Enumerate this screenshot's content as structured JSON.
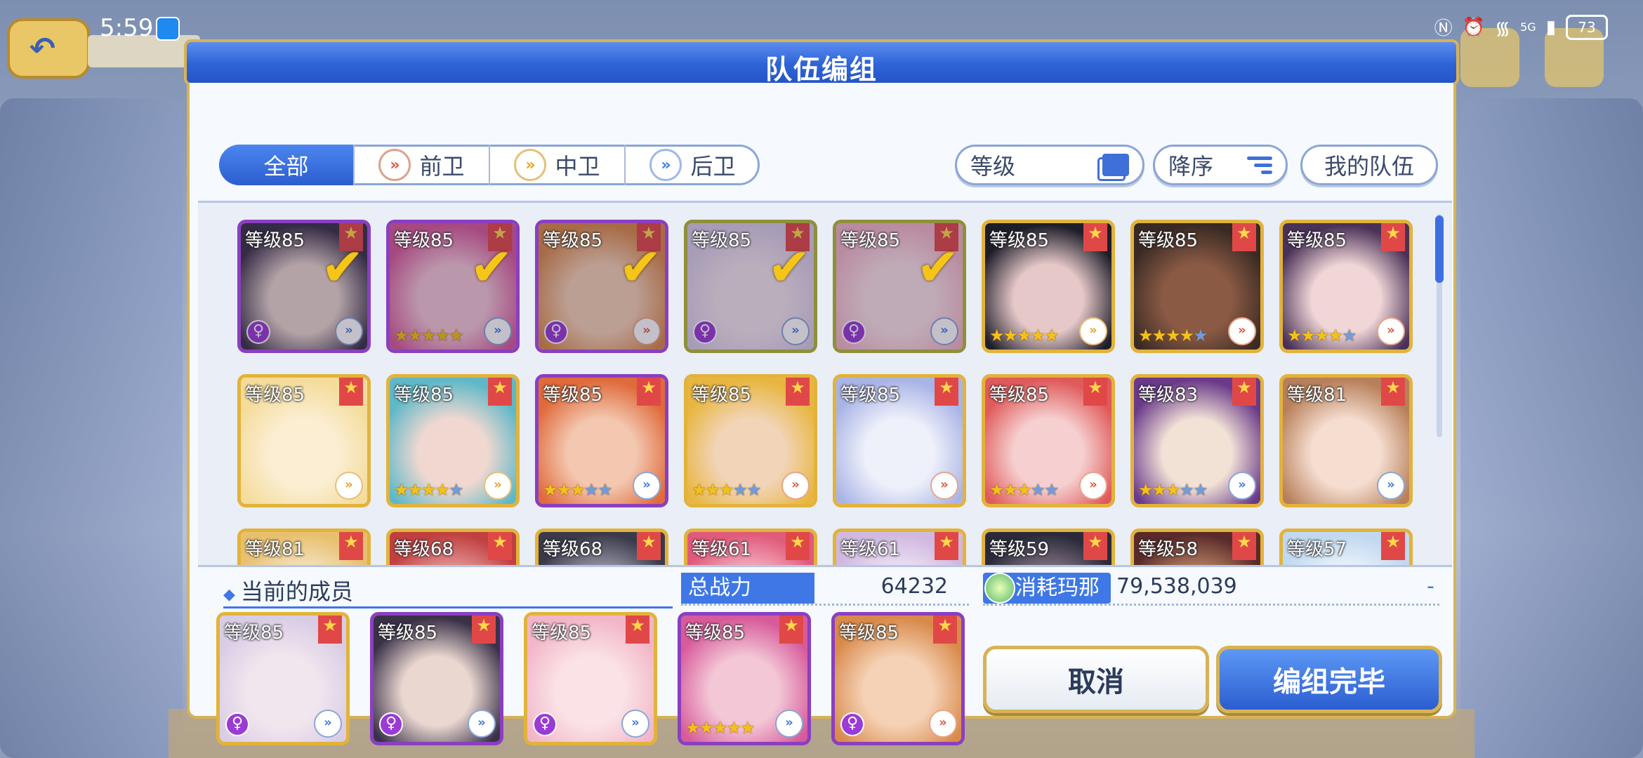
{
  "status_bar": {
    "time": "5:59",
    "battery": "73",
    "network": "5G"
  },
  "dialog": {
    "title": "队伍编组"
  },
  "filters": {
    "tabs": [
      {
        "label": "全部",
        "icon": "",
        "active": true
      },
      {
        "label": "前卫",
        "icon": "front-position-icon",
        "active": false
      },
      {
        "label": "中卫",
        "icon": "mid-position-icon",
        "active": false
      },
      {
        "label": "后卫",
        "icon": "back-position-icon",
        "active": false
      }
    ],
    "level_label": "等级",
    "order_label": "降序",
    "myteam_label": "我的队伍"
  },
  "roster": [
    {
      "level": "等级85",
      "stars": 0,
      "pos": "back",
      "selected": true,
      "badge": true,
      "frame": "purple",
      "art": [
        "#3a3148",
        "#e9d7d0"
      ]
    },
    {
      "level": "等级85",
      "stars": 5,
      "pos": "back",
      "selected": true,
      "badge": false,
      "frame": "purple",
      "art": [
        "#d75a9a",
        "#f3c7d6"
      ]
    },
    {
      "level": "等级85",
      "stars": 0,
      "pos": "front",
      "selected": true,
      "badge": true,
      "frame": "purple",
      "art": [
        "#d98a4a",
        "#f5d1b5"
      ]
    },
    {
      "level": "等级85",
      "stars": 0,
      "pos": "back",
      "selected": true,
      "badge": true,
      "frame": "green",
      "art": [
        "#d9cde6",
        "#f2e6ee"
      ]
    },
    {
      "level": "等级85",
      "stars": 0,
      "pos": "back",
      "selected": true,
      "badge": true,
      "frame": "green",
      "art": [
        "#f2b6c8",
        "#fae2e6"
      ]
    },
    {
      "level": "等级85",
      "stars": 5,
      "pos": "mid",
      "selected": false,
      "badge": false,
      "frame": "gold",
      "art": [
        "#1e1e2a",
        "#e6c8c8"
      ]
    },
    {
      "level": "等级85",
      "stars": 4,
      "pos": "front",
      "selected": false,
      "badge": false,
      "frame": "gold",
      "art": [
        "#3a2a24",
        "#8a5a44"
      ]
    },
    {
      "level": "等级85",
      "stars": 4,
      "pos": "front",
      "selected": false,
      "badge": false,
      "frame": "gold",
      "art": [
        "#4a3158",
        "#f0d6d6"
      ]
    },
    {
      "level": "等级85",
      "stars": 0,
      "pos": "mid",
      "selected": false,
      "badge": false,
      "frame": "gold",
      "art": [
        "#f4dc9a",
        "#fbeed2"
      ]
    },
    {
      "level": "等级85",
      "stars": 4,
      "pos": "mid",
      "selected": false,
      "badge": false,
      "frame": "gold",
      "art": [
        "#5fb8c8",
        "#f0d8d0"
      ]
    },
    {
      "level": "等级85",
      "stars": 3,
      "pos": "back",
      "selected": false,
      "badge": false,
      "frame": "purple",
      "art": [
        "#e06a3a",
        "#f3c7b0"
      ]
    },
    {
      "level": "等级85",
      "stars": 3,
      "pos": "front",
      "selected": false,
      "badge": false,
      "frame": "gold",
      "art": [
        "#e8b640",
        "#f2d4b8"
      ]
    },
    {
      "level": "等级85",
      "stars": 0,
      "pos": "front",
      "selected": false,
      "badge": false,
      "frame": "gold",
      "art": [
        "#a9b4e6",
        "#eef0fa"
      ]
    },
    {
      "level": "等级85",
      "stars": 3,
      "pos": "front",
      "selected": false,
      "badge": false,
      "frame": "gold",
      "art": [
        "#e05a5a",
        "#f6d0d0"
      ]
    },
    {
      "level": "等级83",
      "stars": 3,
      "pos": "back",
      "selected": false,
      "badge": false,
      "frame": "gold",
      "art": [
        "#6a3a8a",
        "#f2e2d6"
      ]
    },
    {
      "level": "等级81",
      "stars": 0,
      "pos": "back",
      "selected": false,
      "badge": false,
      "frame": "gold",
      "art": [
        "#b8805a",
        "#f5ddd0"
      ]
    },
    {
      "level": "等级81",
      "stars": 0,
      "pos": "back",
      "selected": false,
      "badge": false,
      "frame": "gold",
      "art": [
        "#e8c070",
        "#f5e6c8"
      ]
    },
    {
      "level": "等级68",
      "stars": 0,
      "pos": "back",
      "selected": false,
      "badge": false,
      "frame": "gold",
      "art": [
        "#c04040",
        "#e8a0a0"
      ]
    },
    {
      "level": "等级68",
      "stars": 0,
      "pos": "back",
      "selected": false,
      "badge": false,
      "frame": "gold",
      "art": [
        "#3a3a4a",
        "#a0a0b0"
      ]
    },
    {
      "level": "等级61",
      "stars": 0,
      "pos": "back",
      "selected": false,
      "badge": false,
      "frame": "gold",
      "art": [
        "#e05a7a",
        "#f5b8c8"
      ]
    },
    {
      "level": "等级61",
      "stars": 0,
      "pos": "back",
      "selected": false,
      "badge": false,
      "frame": "gold",
      "art": [
        "#d0b8e0",
        "#f0e6f5"
      ]
    },
    {
      "level": "等级59",
      "stars": 0,
      "pos": "back",
      "selected": false,
      "badge": false,
      "frame": "gold",
      "art": [
        "#2a2a3a",
        "#8a7a8a"
      ]
    },
    {
      "level": "等级58",
      "stars": 0,
      "pos": "back",
      "selected": false,
      "badge": false,
      "frame": "gold",
      "art": [
        "#5a2a2a",
        "#c08a6a"
      ]
    },
    {
      "level": "等级57",
      "stars": 0,
      "pos": "back",
      "selected": false,
      "badge": false,
      "frame": "gold",
      "art": [
        "#c0d8f0",
        "#f0f6fc"
      ]
    }
  ],
  "current_members": {
    "label": "当前的成员",
    "members": [
      {
        "level": "等级85",
        "stars": 0,
        "pos": "back",
        "badge": true,
        "frame": "gold",
        "art": [
          "#d9cde6",
          "#f2e6ee"
        ]
      },
      {
        "level": "等级85",
        "stars": 0,
        "pos": "back",
        "badge": true,
        "frame": "purple",
        "art": [
          "#3a3148",
          "#e9d7d0"
        ]
      },
      {
        "level": "等级85",
        "stars": 0,
        "pos": "back",
        "badge": true,
        "frame": "gold",
        "art": [
          "#f2b6c8",
          "#fae2e6"
        ]
      },
      {
        "level": "等级85",
        "stars": 5,
        "pos": "back",
        "badge": false,
        "frame": "purple",
        "art": [
          "#d75a9a",
          "#f3c7d6"
        ]
      },
      {
        "level": "等级85",
        "stars": 0,
        "pos": "front",
        "badge": true,
        "frame": "purple",
        "art": [
          "#d98a4a",
          "#f5d1b5"
        ]
      }
    ]
  },
  "stats": {
    "power_label": "总战力",
    "power_value": "64232",
    "mana_label": "消耗玛那",
    "mana_value": "79,538,039",
    "mana_extra": "-"
  },
  "buttons": {
    "cancel": "取消",
    "done": "编组完毕"
  },
  "colors": {
    "accent": "#3f78e6",
    "frame_gold": "#d7b356",
    "check": "#f5c518"
  }
}
